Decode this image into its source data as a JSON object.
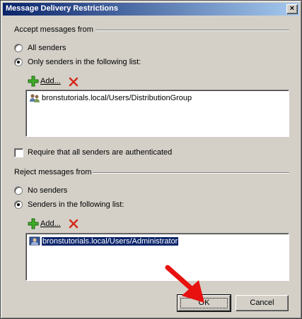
{
  "window": {
    "title": "Message Delivery Restrictions",
    "close_glyph": "×"
  },
  "accept": {
    "heading": "Accept messages from",
    "all_senders_label": "All senders",
    "all_senders_checked": false,
    "only_senders_label": "Only senders in the following list:",
    "only_senders_checked": true,
    "add_label": "Add...",
    "items": [
      {
        "text": "bronstutorials.local/Users/DistributionGroup",
        "icon": "group-icon",
        "selected": false
      }
    ]
  },
  "require_auth": {
    "label": "Require that all senders are authenticated",
    "checked": false
  },
  "reject": {
    "heading": "Reject messages from",
    "no_senders_label": "No senders",
    "no_senders_checked": false,
    "senders_label": "Senders in the following list:",
    "senders_checked": true,
    "add_label": "Add...",
    "items": [
      {
        "text": "bronstutorials.local/Users/Administrator",
        "icon": "user-icon",
        "selected": true
      }
    ]
  },
  "buttons": {
    "ok": "OK",
    "cancel": "Cancel"
  },
  "colors": {
    "title_start": "#0a246a",
    "title_end": "#a6caf0",
    "selection": "#0a246a",
    "annotation_arrow": "#e8110f"
  }
}
